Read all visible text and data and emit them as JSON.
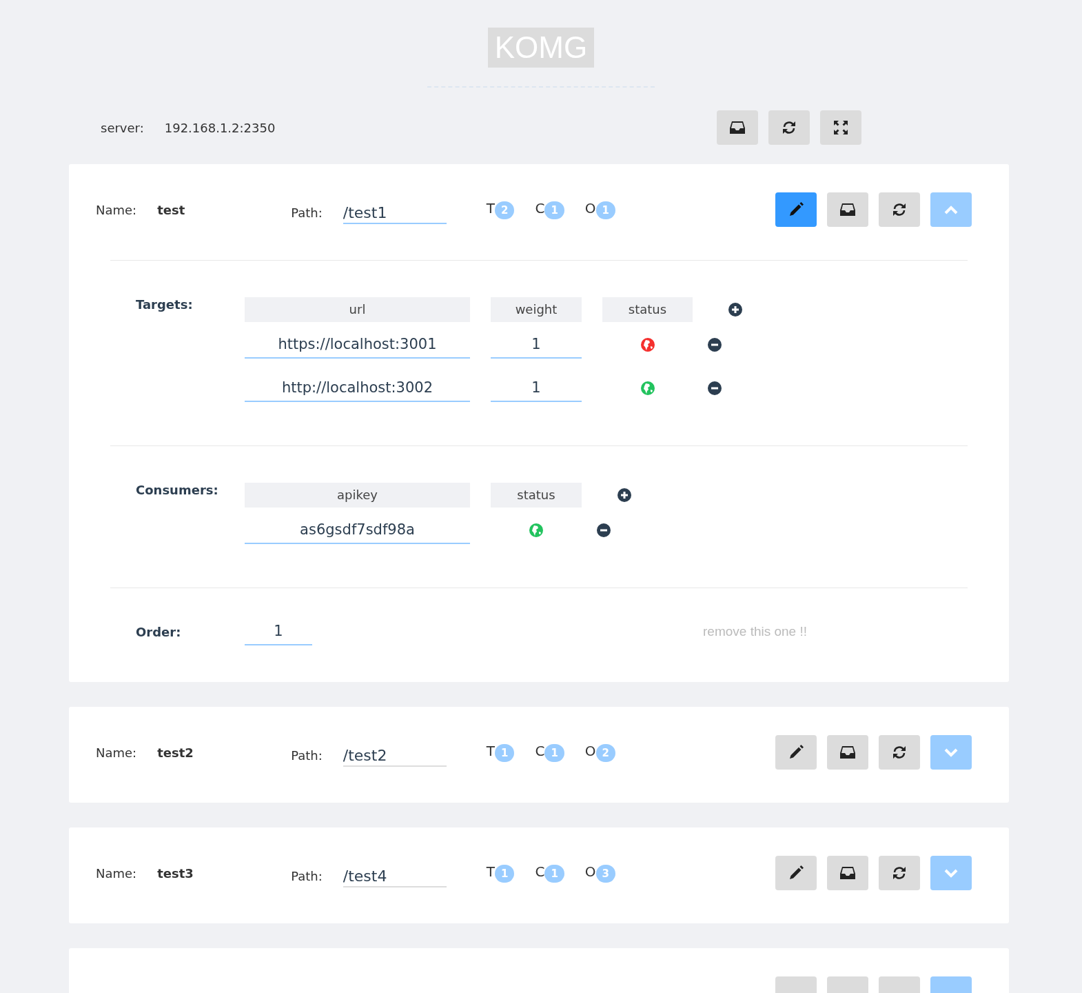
{
  "title": "KOMG",
  "server": {
    "label": "server:",
    "value": "192.168.1.2:2350"
  },
  "cards": [
    {
      "name_label": "Name:",
      "name": "test",
      "path_label": "Path:",
      "path": "/test1",
      "badges": [
        {
          "letter": "T",
          "count": "2"
        },
        {
          "letter": "C",
          "count": "1"
        },
        {
          "letter": "O",
          "count": "1"
        }
      ],
      "editing": true,
      "expanded": true,
      "targets": {
        "label": "Targets:",
        "columns": [
          "url",
          "weight",
          "status"
        ],
        "rows": [
          {
            "url": "https://localhost:3001",
            "weight": "1",
            "online": false
          },
          {
            "url": "http://localhost:3002",
            "weight": "1",
            "online": true
          }
        ]
      },
      "consumers": {
        "label": "Consumers:",
        "columns": [
          "apikey",
          "status"
        ],
        "rows": [
          {
            "apikey": "as6gsdf7sdf98a",
            "online": true
          }
        ]
      },
      "order": {
        "label": "Order:",
        "value": "1"
      },
      "remove": "remove this one !!"
    },
    {
      "name_label": "Name:",
      "name": "test2",
      "path_label": "Path:",
      "path": "/test2",
      "badges": [
        {
          "letter": "T",
          "count": "1"
        },
        {
          "letter": "C",
          "count": "1"
        },
        {
          "letter": "O",
          "count": "2"
        }
      ],
      "editing": false,
      "expanded": false
    },
    {
      "name_label": "Name:",
      "name": "test3",
      "path_label": "Path:",
      "path": "/test4",
      "badges": [
        {
          "letter": "T",
          "count": "1"
        },
        {
          "letter": "C",
          "count": "1"
        },
        {
          "letter": "O",
          "count": "3"
        }
      ],
      "editing": false,
      "expanded": false
    },
    {
      "editing": false,
      "expanded": false
    }
  ]
}
